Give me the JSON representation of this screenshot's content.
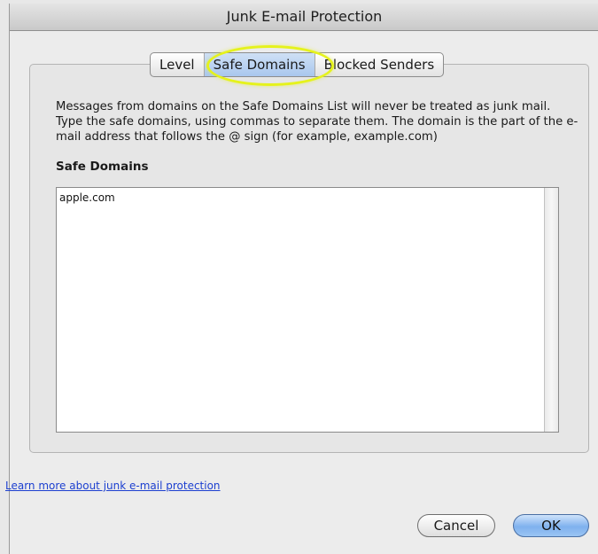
{
  "window": {
    "title": "Junk E-mail Protection"
  },
  "tabs": {
    "items": [
      {
        "label": "Level",
        "selected": false
      },
      {
        "label": "Safe Domains",
        "selected": true
      },
      {
        "label": "Blocked Senders",
        "selected": false
      }
    ]
  },
  "panel": {
    "description": "Messages from domains on the Safe Domains List will never be treated as junk mail. Type the safe domains, using commas to separate them.  The domain is the part of the e-mail address that follows the @ sign (for example, example.com)",
    "section_label": "Safe Domains",
    "textarea_value": "apple.com"
  },
  "footer": {
    "learn_more_link": "Learn more about junk e-mail protection",
    "cancel_label": "Cancel",
    "ok_label": "OK"
  },
  "colors": {
    "highlight": "#e5f21c",
    "link": "#1c3fd0",
    "default_button": "#7fb1ee"
  }
}
